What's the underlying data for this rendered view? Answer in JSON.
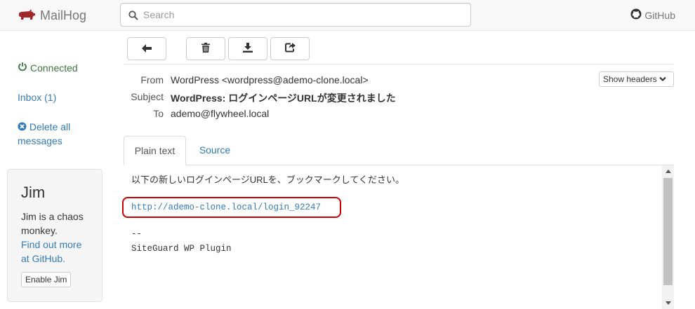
{
  "app": {
    "brand": "MailHog",
    "brand_color": "#a0262a"
  },
  "search": {
    "placeholder": "Search",
    "value": ""
  },
  "header_links": {
    "github": "GitHub"
  },
  "sidebar": {
    "connected": "Connected",
    "inbox": "Inbox (1)",
    "delete_all": "Delete all messages"
  },
  "jim": {
    "title": "Jim",
    "text": "Jim is a chaos monkey.",
    "link": "Find out more at GitHub.",
    "button": "Enable Jim"
  },
  "toolbar": {
    "buttons": [
      {
        "name": "back-button",
        "icon": "arrow-left-icon"
      },
      {
        "name": "delete-button",
        "icon": "trash-icon"
      },
      {
        "name": "download-button",
        "icon": "download-icon"
      },
      {
        "name": "release-button",
        "icon": "share-icon"
      }
    ]
  },
  "message": {
    "from_label": "From",
    "from": "WordPress <wordpress@ademo-clone.local>",
    "subject_label": "Subject",
    "subject": "WordPress: ログインページURLが変更されました",
    "to_label": "To",
    "to": "ademo@flywheel.local",
    "show_headers": "Show headers"
  },
  "tabs": [
    {
      "label": "Plain text",
      "active": true
    },
    {
      "label": "Source",
      "active": false
    }
  ],
  "body": {
    "line1": "以下の新しいログインページURLを、ブックマークしてください。",
    "link": "http://ademo-clone.local/login_92247",
    "sig_sep": "--",
    "sig_name": "SiteGuard WP Plugin"
  },
  "colors": {
    "link": "#337ab7",
    "connected": "#3c763d",
    "highlight": "#cc0000"
  }
}
